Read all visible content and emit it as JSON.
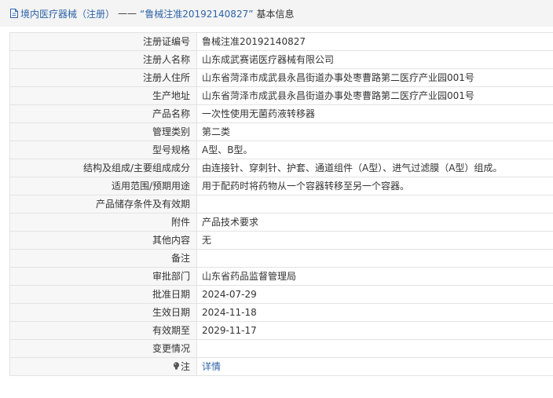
{
  "header": {
    "category": "境内医疗器械（注册）",
    "separator": "——",
    "title": "“鲁械注准20192140827”",
    "suffix": "基本信息"
  },
  "rows": [
    {
      "label": "注册证编号",
      "value": "鲁械注准20192140827"
    },
    {
      "label": "注册人名称",
      "value": "山东成武赛诺医疗器械有限公司"
    },
    {
      "label": "注册人住所",
      "value": "山东省菏泽市成武县永昌街道办事处枣曹路第二医疗产业园001号"
    },
    {
      "label": "生产地址",
      "value": "山东省菏泽市成武县永昌街道办事处枣曹路第二医疗产业园001号"
    },
    {
      "label": "产品名称",
      "value": "一次性使用无菌药液转移器"
    },
    {
      "label": "管理类别",
      "value": "第二类"
    },
    {
      "label": "型号规格",
      "value": "A型、B型。"
    },
    {
      "label": "结构及组成/主要组成成分",
      "value": "由连接针、穿刺针、护套、通道组件（A型）、进气过滤膜（A型）组成。"
    },
    {
      "label": "适用范围/预期用途",
      "value": "用于配药时将药物从一个容器转移至另一个容器。"
    },
    {
      "label": "产品储存条件及有效期",
      "value": ""
    },
    {
      "label": "附件",
      "value": "产品技术要求"
    },
    {
      "label": "其他内容",
      "value": "无"
    },
    {
      "label": "备注",
      "value": ""
    },
    {
      "label": "审批部门",
      "value": "山东省药品监督管理局"
    },
    {
      "label": "批准日期",
      "value": "2024-07-29"
    },
    {
      "label": "生效日期",
      "value": "2024-11-18"
    },
    {
      "label": "有效期至",
      "value": "2029-11-17"
    },
    {
      "label": "变更情况",
      "value": ""
    }
  ],
  "note_row": {
    "label": "注",
    "link": "详情"
  },
  "colors": {
    "link": "#2f63a8",
    "label_bg": "#f7f7f7",
    "border": "#e3e3e3",
    "title_bg": "#f4f4f4"
  },
  "icons": {
    "title": "document-icon",
    "note": "lightbulb-icon"
  }
}
